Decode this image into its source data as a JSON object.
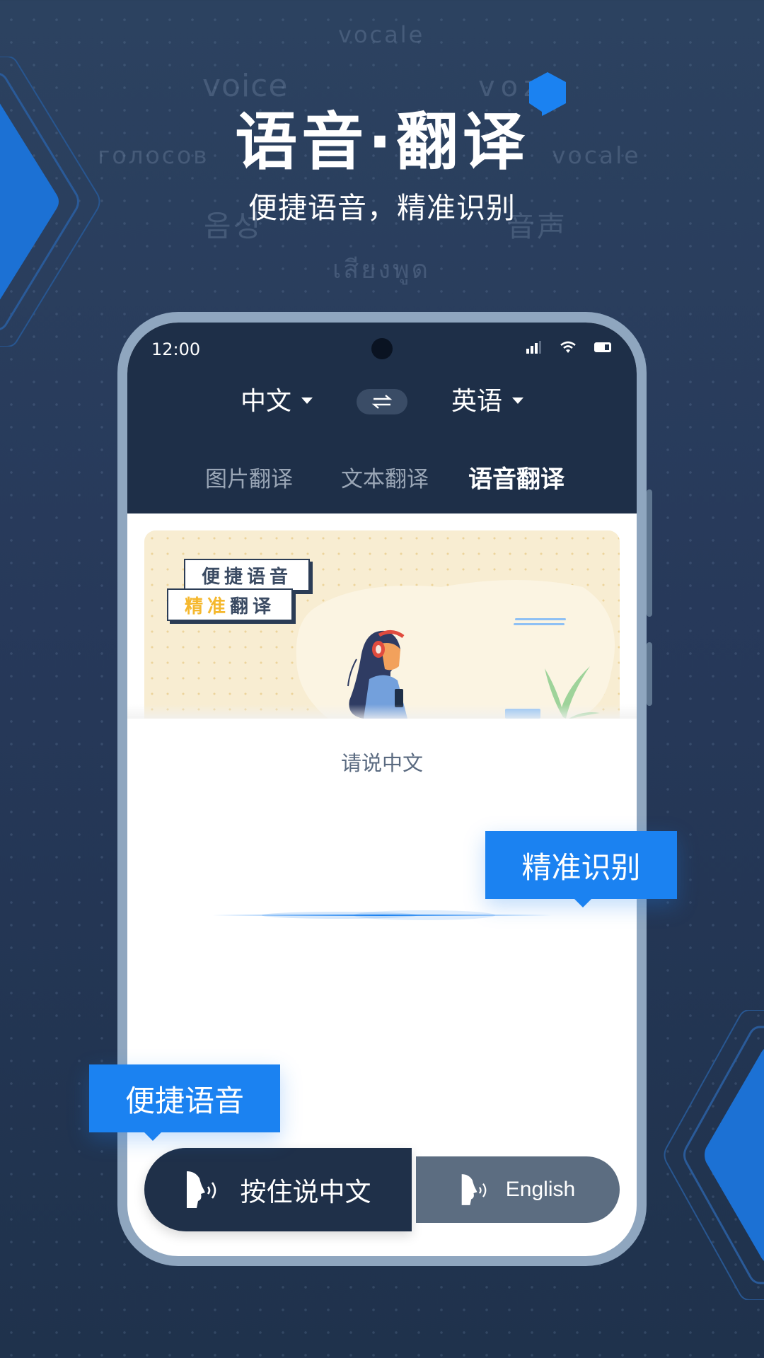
{
  "background_words": {
    "w1": "vocale",
    "w2": "voice",
    "w3": "voz",
    "w4": "голосов",
    "w5": "vocale",
    "w6": "음성",
    "w7": "音声",
    "w8": "เสียงพูด"
  },
  "hero": {
    "title": "语音·翻译",
    "subtitle": "便捷语音，精准识别"
  },
  "colors": {
    "accent": "#1b82f1",
    "phone_frame": "#8fa6bf",
    "app_header": "#1e2f48",
    "secondary_button": "#5c6d81",
    "highlight_yellow": "#f5b82e"
  },
  "status_bar": {
    "time": "12:00",
    "icons": [
      "signal-icon",
      "wifi-icon",
      "battery-icon"
    ]
  },
  "language_selector": {
    "source": "中文",
    "target": "英语",
    "swap_icon": "swap-arrows-icon"
  },
  "tabs": [
    {
      "label": "图片翻译",
      "active": false
    },
    {
      "label": "文本翻译",
      "active": false
    },
    {
      "label": "语音翻译",
      "active": true
    }
  ],
  "banner": {
    "tag1": "便捷语音",
    "tag2_highlight": "精准",
    "tag2_rest": "翻译"
  },
  "main": {
    "prompt": "请说中文"
  },
  "buttons": {
    "hold_to_speak_cn": "按住说中文",
    "english": "English"
  },
  "callouts": {
    "accurate": "精准识别",
    "convenient": "便捷语音"
  }
}
